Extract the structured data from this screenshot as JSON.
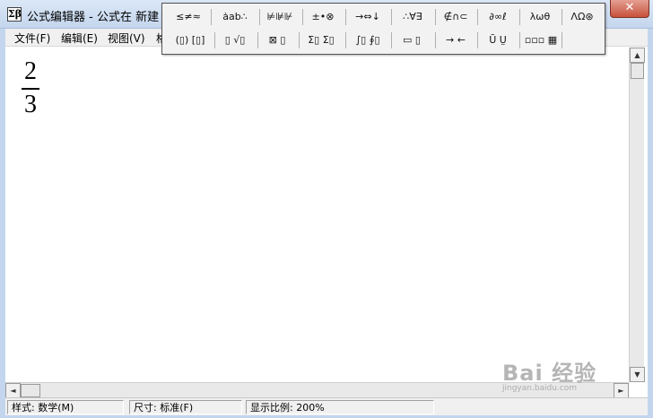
{
  "window": {
    "title": "公式编辑器 - 公式在 新建 M",
    "app_icon": "Σβ",
    "close_symbol": "✕"
  },
  "menu": {
    "items": [
      "文件(F)",
      "编辑(E)",
      "视图(V)",
      "格"
    ]
  },
  "toolbar": {
    "row1": [
      "≤≠≈",
      "ȧab∴",
      "⊭⊯⊮",
      "±•⊗",
      "→⇔↓",
      "∴∀∃",
      "∉∩⊂",
      "∂∞ℓ",
      "λωθ",
      "ΛΩ⊛"
    ],
    "row2": [
      "(▯) [▯]",
      "▯ √▯",
      "⊠ ▯",
      "Σ▯ Σ▯",
      "∫▯ ∮▯",
      "▭ ▯",
      "→ ←",
      "Ū Ṳ",
      "▫▫▫ ▦"
    ]
  },
  "editor": {
    "numerator": "2",
    "denominator": "3"
  },
  "scroll": {
    "up": "▲",
    "down": "▼",
    "left": "◄",
    "right": "►"
  },
  "status": {
    "style": "样式: 数学(M)",
    "size": "尺寸: 标准(F)",
    "zoom": "显示比例: 200%"
  },
  "watermark": {
    "main": "Bai 经验",
    "sub": "jingyan.baidu.com"
  }
}
